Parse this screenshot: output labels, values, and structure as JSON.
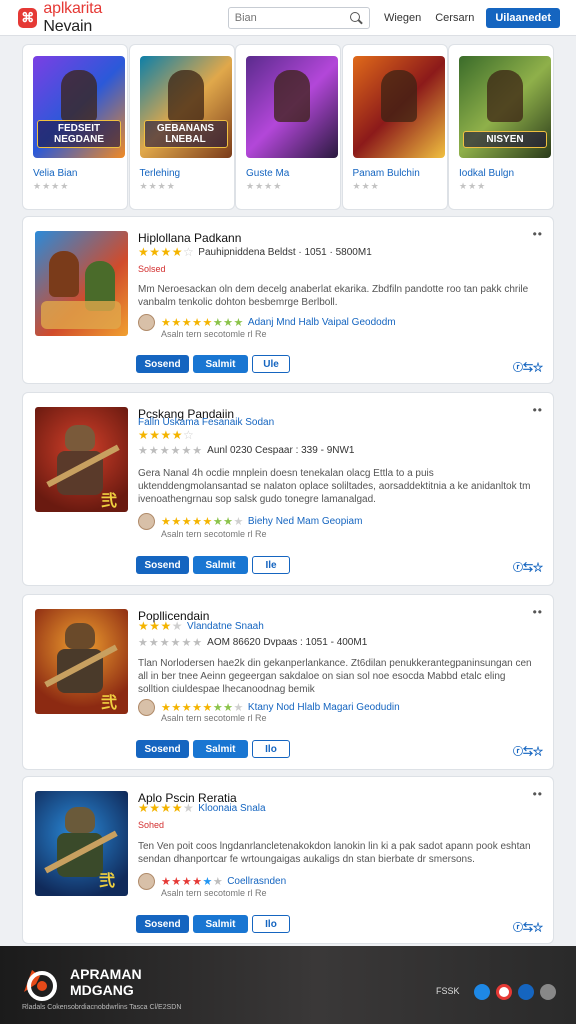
{
  "header": {
    "logo_icon": "app-store-logo",
    "logo_text_red": "aplkarita",
    "logo_text_dark": " Nevain",
    "search_placeholder": "Bian",
    "nav": [
      "Wiegen",
      "Cersarn"
    ],
    "cta": "Uilaanedet"
  },
  "featured": [
    {
      "title": "Velia Bian",
      "stars": "★★★★"
    },
    {
      "title": "Terlehing",
      "stars": "★★★★"
    },
    {
      "title": "Guste Ma",
      "stars": "★★★★"
    },
    {
      "title": "Panam Bulchin",
      "stars": "★★★"
    },
    {
      "title": "Iodkal Bulgn",
      "stars": "★★★"
    }
  ],
  "featured_art": [
    {
      "caption": "FEDSEIT NEGDANE",
      "colors": [
        "#7b3fe4",
        "#2b59d9",
        "#f08a24"
      ]
    },
    {
      "caption": "GEBANANS LNEBAL",
      "colors": [
        "#0d7fa8",
        "#e0a84b",
        "#7a3b1a"
      ]
    },
    {
      "caption": "",
      "colors": [
        "#5a2b8c",
        "#b347d9",
        "#2a1a3e"
      ]
    },
    {
      "caption": "",
      "colors": [
        "#e06a1a",
        "#8c1a1a",
        "#f0c040"
      ]
    },
    {
      "caption": "NISYEN",
      "colors": [
        "#3a6b2a",
        "#8fb04a",
        "#2a3a1a"
      ]
    }
  ],
  "apps": [
    {
      "title": "Hiplollana Padkann",
      "subtitle": "",
      "inline_meta": "Pauhipniddena  Beldst · 1051 · 5800M1",
      "badge": "Solsed",
      "meta_line": "",
      "description": "Mm Neroesackan oln dem decelg anaberlat ekarika. Zbdfiln pandotte roo tan pakk chrile vanbalm tenkolic dohton besbemrge Berlboll.",
      "review_name": "Adanj Mnd Halb Vaipal Geododm",
      "review_sub": "Asaln tern secotomle rl Re",
      "buttons": [
        "Sosend",
        "Salmit",
        "Ule"
      ],
      "share": "ⓡ⇆☆"
    },
    {
      "title": "Pcskang Pandaiin",
      "subtitle": "Falln Uskama  Fesanaik Sodan",
      "inline_meta": "",
      "badge": "",
      "meta_line": "Aunl 0230 Cespaar : 339 - 9NW1",
      "description": "Gera Nanal 4h ocdie mnplein doesn tenekalan olacg Ettla to a puis uktenddengmolansantad se nalaton oplace soliltades, aorsaddektitnia a ke anidanltok tm ivenoathengrnau sop salsk gudo tonegre lamanalgad.",
      "review_name": "Biehy Ned Mam Geopiam",
      "review_sub": "Asaln tern secotomle rl Re",
      "buttons": [
        "Sosend",
        "Salmit",
        "Ile"
      ],
      "share": "ⓡ⇆☆"
    },
    {
      "title": "Popllicendain",
      "subtitle": "Vlandatne Snaah",
      "inline_meta": "",
      "badge": "",
      "meta_line": "AOM 86620 Dvpaas : 1051 - 400M1",
      "description": "Tlan Norlodersen hae2k din gekanperlankance. Zt6dilan penukkerantegpaninsungan cen all in ber tnee Aeinn gegeergan sakdaloe on sian sol noe esocda Mabbd etalc eling solltion ciuldespae lhecanoodnag bemik",
      "review_name": "Ktany Nod Hlalb Magari Geodudin",
      "review_sub": "Asaln tern secotomle rl Re",
      "buttons": [
        "Sosend",
        "Salmit",
        "Ilo"
      ],
      "share": "ⓡ⇆☆"
    },
    {
      "title": "Aplo Pscin Reratia",
      "subtitle": "Kloonaia Snala",
      "inline_meta": "",
      "badge": "Sohed",
      "meta_line": "",
      "description": "Ten Ven poit coos lngdanrlancletenakokdon lanokin lin ki a pak sadot apann pook eshtan sendan dhanportcar fe wrtoungaigas aukaligs dn stan bierbate dr smersons.",
      "review_name": "Coellrasnden",
      "review_sub": "Asaln tern secotomle rl Re",
      "buttons": [
        "Sosend",
        "Salmit",
        "Ilo"
      ],
      "share": "ⓡ⇆☆"
    }
  ],
  "footer": {
    "brand_line1": "APRAMAN",
    "brand_line2": "MDGANG",
    "copyright": "Rladals Cokensobrdiacnobdwrlins Tasca Cl/E2SDN",
    "social_label": "FSSK",
    "social_colors": [
      "#1e88e5",
      "#e53935",
      "#1565c0",
      "#888888"
    ]
  }
}
